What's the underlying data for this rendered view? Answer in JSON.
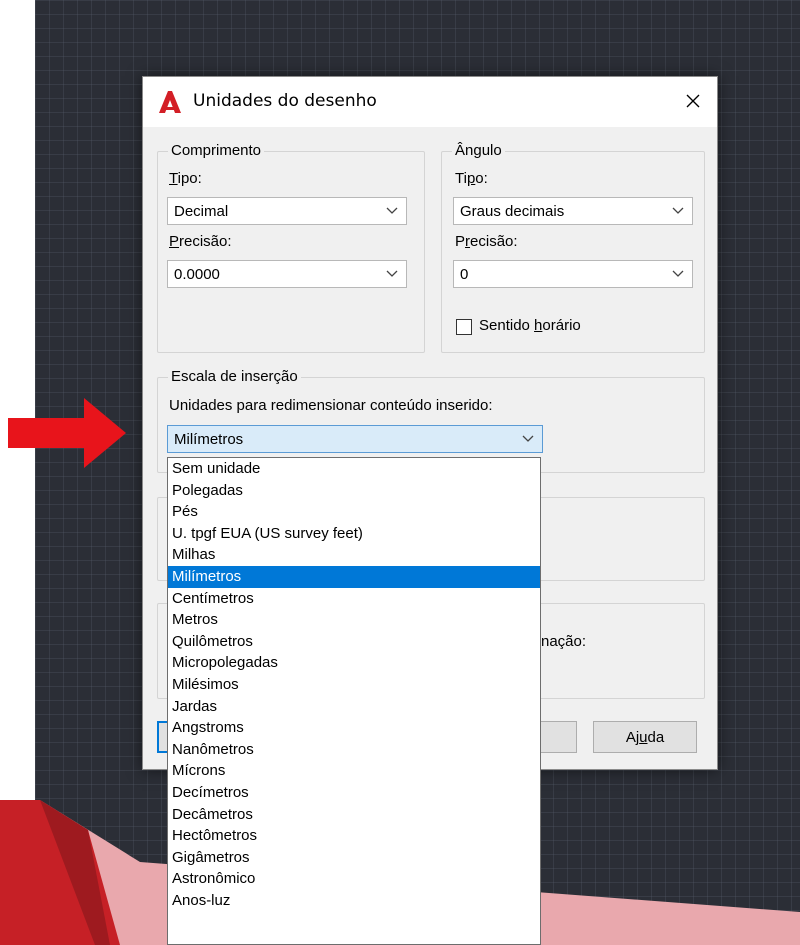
{
  "dialog": {
    "title": "Unidades do desenho",
    "close_glyph": "×",
    "length": {
      "group_title": "Comprimento",
      "type_label_key": "T",
      "type_label_rest": "ipo:",
      "type_value": "Decimal",
      "precision_label_key": "P",
      "precision_label_rest": "recisão:",
      "precision_value": "0.0000"
    },
    "angle": {
      "group_title": "Ângulo",
      "type_label_pre": "Ti",
      "type_label_key": "p",
      "type_label_rest": "o:",
      "type_value": "Graus decimais",
      "precision_label_pre": "P",
      "precision_label_key": "r",
      "precision_label_rest": "ecisão:",
      "precision_value": "0",
      "clockwise_pre": "Sentido ",
      "clockwise_key": "h",
      "clockwise_rest": "orário",
      "clockwise_checked": false
    },
    "insertion": {
      "group_title": "Escala de inserção",
      "units_label": "Unidades para redimensionar conteúdo inserido:",
      "units_value": "Milímetros"
    },
    "lighting_partial_text": "nação:",
    "help_button_pre": "Aj",
    "help_button_key": "u",
    "help_button_rest": "da"
  },
  "dropdown": {
    "selected_index": 5,
    "options": [
      "Sem unidade",
      "Polegadas",
      "Pés",
      "U. tpgf EUA (US survey feet)",
      "Milhas",
      "Milímetros",
      "Centímetros",
      "Metros",
      "Quilômetros",
      "Micropolegadas",
      "Milésimos",
      "Jardas",
      "Angstroms",
      "Nanômetros",
      "Mícrons",
      "Decímetros",
      "Decâmetros",
      "Hectômetros",
      "Gigâmetros",
      "Astronômico",
      "Anos-luz"
    ]
  },
  "colors": {
    "arrow": "#e8141b",
    "selection": "#0078d7",
    "autocad_red": "#d31f26"
  }
}
